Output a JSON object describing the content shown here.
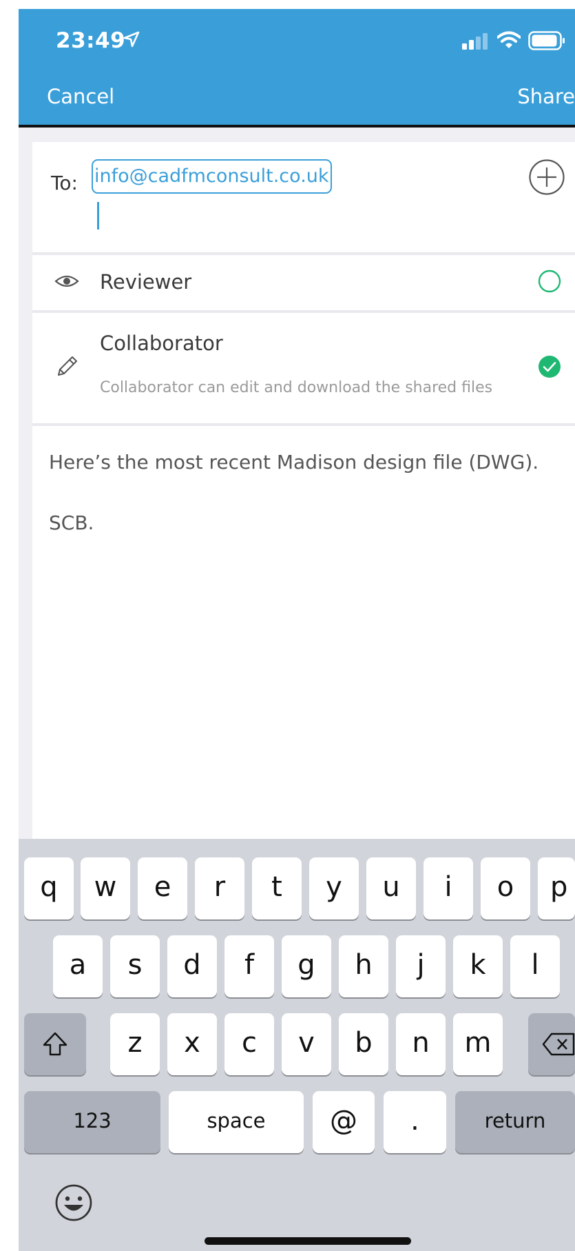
{
  "status_bar": {
    "time": "23:49",
    "icons": [
      "location-arrow-icon",
      "cellular-signal-icon",
      "wifi-icon",
      "battery-icon"
    ]
  },
  "nav": {
    "cancel_label": "Cancel",
    "share_label": "Share",
    "bar_color": "#3a9fd9"
  },
  "recipients": {
    "to_label": "To:",
    "chips": [
      "info@cadfmconsult.co.uk"
    ],
    "add_icon": "plus-circle-icon"
  },
  "roles": [
    {
      "title": "Reviewer",
      "icon": "eye-icon",
      "selected": false
    },
    {
      "title": "Collaborator",
      "icon": "pencil-icon",
      "selected": true,
      "description": "Collaborator can edit and download the shared files"
    }
  ],
  "message": {
    "lines": [
      "Here’s the most recent Madison design file (DWG).",
      "SCB."
    ]
  },
  "keyboard": {
    "row1": [
      "q",
      "w",
      "e",
      "r",
      "t",
      "y",
      "u",
      "i",
      "o",
      "p"
    ],
    "row2": [
      "a",
      "s",
      "d",
      "f",
      "g",
      "h",
      "j",
      "k",
      "l"
    ],
    "row3": [
      "z",
      "x",
      "c",
      "v",
      "b",
      "n",
      "m"
    ],
    "numbers_label": "123",
    "space_label": "space",
    "at_label": "@",
    "dot_label": ".",
    "return_label": "return",
    "emoji_icon": "smiley-face-icon"
  },
  "colors": {
    "accent": "#3a9fd9",
    "success": "#1fb873",
    "keyboard_bg": "#d1d4da"
  }
}
